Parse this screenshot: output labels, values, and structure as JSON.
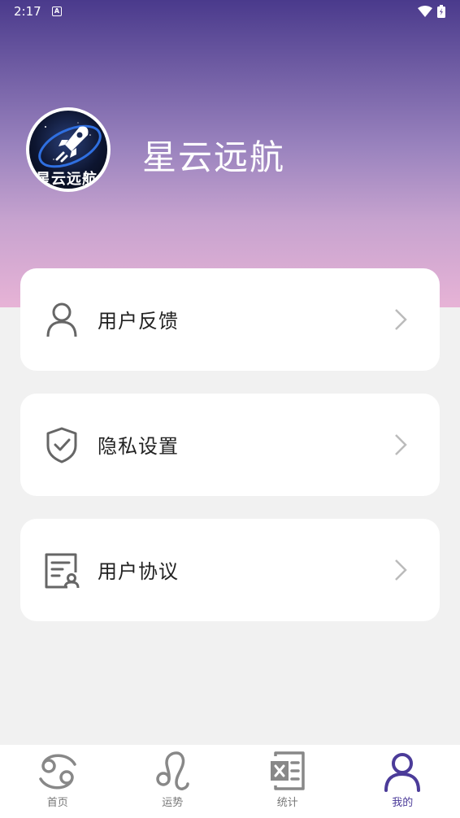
{
  "status_bar": {
    "time": "2:17",
    "notification_badge": "A"
  },
  "profile": {
    "app_name": "星云远航",
    "avatar_text": "星云远航"
  },
  "menu": [
    {
      "label": "用户反馈",
      "icon": "user-icon"
    },
    {
      "label": "隐私设置",
      "icon": "shield-check-icon"
    },
    {
      "label": "用户协议",
      "icon": "document-user-icon"
    }
  ],
  "tabbar": {
    "active": "我的",
    "tabs": [
      {
        "label": "首页",
        "icon": "cancer-zodiac-icon"
      },
      {
        "label": "运势",
        "icon": "leo-zodiac-icon"
      },
      {
        "label": "统计",
        "icon": "spreadsheet-icon"
      },
      {
        "label": "我的",
        "icon": "profile-icon"
      }
    ]
  },
  "colors": {
    "accent": "#4b3b99",
    "hero_top": "#4a3a8c",
    "hero_bottom": "#e7b3d6",
    "icon_gray": "#666666",
    "background": "#f1f1f1"
  }
}
